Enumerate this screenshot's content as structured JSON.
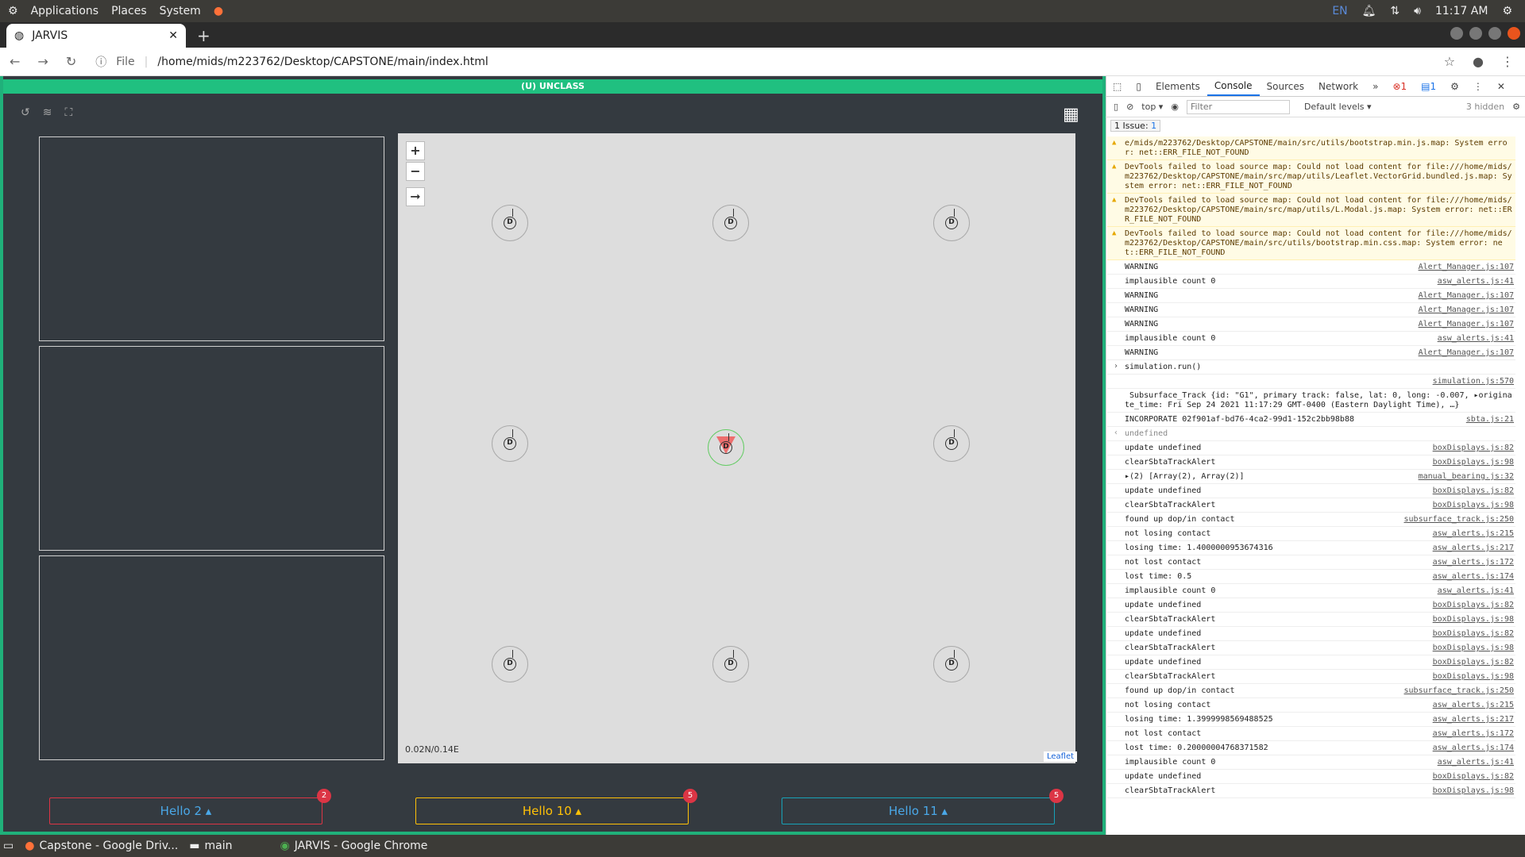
{
  "panel": {
    "menus": [
      "Applications",
      "Places",
      "System"
    ],
    "lang": "EN",
    "time": "11:17 AM"
  },
  "tab": {
    "title": "JARVIS"
  },
  "address": {
    "scheme": "File",
    "url": "/home/mids/m223762/Desktop/CAPSTONE/main/index.html"
  },
  "app": {
    "banner": "(U) UNCLASS",
    "coord": "0.02N/0.14E",
    "attribution": "Leaflet",
    "buttons": [
      {
        "label": "Hello 2",
        "badge": "2",
        "color": "#dc3545"
      },
      {
        "label": "Hello 10",
        "badge": "5",
        "color": "#ffc107"
      },
      {
        "label": "Hello 11",
        "badge": "5",
        "color": "#17a2b8"
      }
    ],
    "sonobuoy_label": "D"
  },
  "devtools": {
    "tabs": [
      "Elements",
      "Console",
      "Sources",
      "Network"
    ],
    "errors": "1",
    "messages": "1",
    "context": "top",
    "filter_placeholder": "Filter",
    "levels": "Default levels ▾",
    "hidden": "3 hidden",
    "issues_label": "1 Issue:",
    "issues_count": "1"
  },
  "log": [
    {
      "t": "warn",
      "m": "e/mids/m223762/Desktop/CAPSTONE/main/src/utils/bootstrap.min.js.map: System error: net::ERR_FILE_NOT_FOUND"
    },
    {
      "t": "warn",
      "m": "DevTools failed to load source map: Could not load content for file:///home/mids/m223762/Desktop/CAPSTONE/main/src/map/utils/Leaflet.VectorGrid.bundled.js.map: System error: net::ERR_FILE_NOT_FOUND"
    },
    {
      "t": "warn",
      "m": "DevTools failed to load source map: Could not load content for file:///home/mids/m223762/Desktop/CAPSTONE/main/src/map/utils/L.Modal.js.map: System error: net::ERR_FILE_NOT_FOUND"
    },
    {
      "t": "warn",
      "m": "DevTools failed to load source map: Could not load content for file:///home/mids/m223762/Desktop/CAPSTONE/main/src/utils/bootstrap.min.css.map: System error: net::ERR_FILE_NOT_FOUND"
    },
    {
      "m": "WARNING",
      "s": "Alert_Manager.js:107"
    },
    {
      "m": "implausible count 0",
      "s": "asw_alerts.js:41"
    },
    {
      "m": "WARNING",
      "s": "Alert_Manager.js:107"
    },
    {
      "m": "WARNING",
      "s": "Alert_Manager.js:107"
    },
    {
      "m": "WARNING",
      "s": "Alert_Manager.js:107"
    },
    {
      "m": "implausible count 0",
      "s": "asw_alerts.js:41"
    },
    {
      "m": "WARNING",
      "s": "Alert_Manager.js:107"
    },
    {
      "t": "cmd",
      "m": "simulation.run()"
    },
    {
      "m": "",
      "s": "simulation.js:570"
    },
    {
      "m": " Subsurface_Track {id: \"G1\", primary track: false, lat: 0, long: -0.007, ▸originate_time: Fri Sep 24 2021 11:17:29 GMT-0400 (Eastern Daylight Time), …}"
    },
    {
      "m": "INCORPORATE 02f901af-bd76-4ca2-99d1-152c2bb98b88",
      "s": "sbta.js:21"
    },
    {
      "t": "ret",
      "m": "undefined"
    },
    {
      "m": "update undefined",
      "s": "boxDisplays.js:82"
    },
    {
      "m": "clearSbtaTrackAlert",
      "s": "boxDisplays.js:98"
    },
    {
      "m": "▸(2) [Array(2), Array(2)]",
      "s": "manual_bearing.js:32"
    },
    {
      "m": "update undefined",
      "s": "boxDisplays.js:82"
    },
    {
      "m": "clearSbtaTrackAlert",
      "s": "boxDisplays.js:98"
    },
    {
      "m": "found up dop/in contact",
      "s": "subsurface_track.js:250"
    },
    {
      "m": "not losing contact",
      "s": "asw_alerts.js:215"
    },
    {
      "m": "losing time: 1.4000000953674316",
      "s": "asw_alerts.js:217"
    },
    {
      "m": "not lost contact",
      "s": "asw_alerts.js:172"
    },
    {
      "m": "lost time: 0.5",
      "s": "asw_alerts.js:174"
    },
    {
      "m": "implausible count 0",
      "s": "asw_alerts.js:41"
    },
    {
      "m": "update undefined",
      "s": "boxDisplays.js:82"
    },
    {
      "m": "clearSbtaTrackAlert",
      "s": "boxDisplays.js:98"
    },
    {
      "m": "update undefined",
      "s": "boxDisplays.js:82"
    },
    {
      "m": "clearSbtaTrackAlert",
      "s": "boxDisplays.js:98"
    },
    {
      "m": "update undefined",
      "s": "boxDisplays.js:82"
    },
    {
      "m": "clearSbtaTrackAlert",
      "s": "boxDisplays.js:98"
    },
    {
      "m": "found up dop/in contact",
      "s": "subsurface_track.js:250"
    },
    {
      "m": "not losing contact",
      "s": "asw_alerts.js:215"
    },
    {
      "m": "losing time: 1.3999998569488525",
      "s": "asw_alerts.js:217"
    },
    {
      "m": "not lost contact",
      "s": "asw_alerts.js:172"
    },
    {
      "m": "lost time: 0.20000004768371582",
      "s": "asw_alerts.js:174"
    },
    {
      "m": "implausible count 0",
      "s": "asw_alerts.js:41"
    },
    {
      "m": "update undefined",
      "s": "boxDisplays.js:82"
    },
    {
      "m": "clearSbtaTrackAlert",
      "s": "boxDisplays.js:98"
    }
  ],
  "taskbar": {
    "items": [
      "Capstone - Google Driv...",
      "main",
      "JARVIS - Google Chrome"
    ]
  }
}
